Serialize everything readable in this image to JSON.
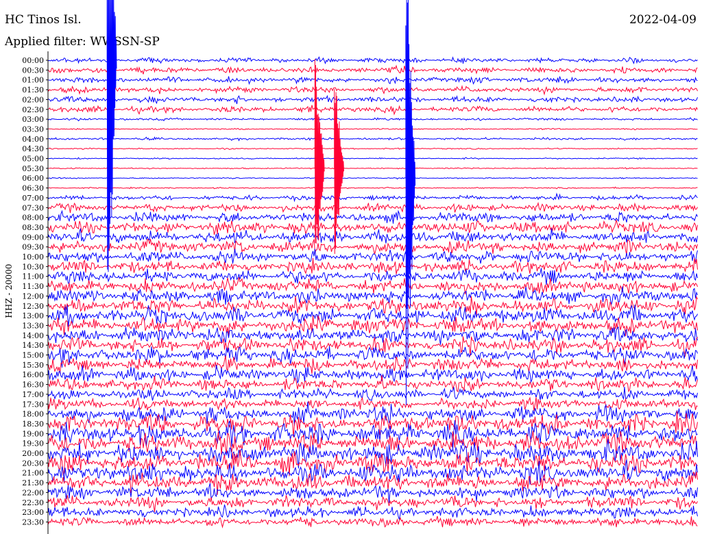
{
  "header": {
    "station": "HC Tinos Isl.",
    "date": "2022-04-09",
    "filter": "Applied filter: WWSSN-SP"
  },
  "channel_label": "HHZ - 20000",
  "colors": {
    "trace_a": "#0000ff",
    "trace_b": "#ff0033",
    "background": "#ffffff"
  },
  "chart_data": {
    "type": "line",
    "title": "HC Tinos Isl.",
    "subtitle": "Applied filter: WWSSN-SP",
    "ylabel": "HHZ - 20000",
    "xlabel": "",
    "y_tick_labels": [
      "00:00",
      "00:30",
      "01:00",
      "01:30",
      "02:00",
      "02:30",
      "03:00",
      "03:30",
      "04:00",
      "04:30",
      "05:00",
      "05:30",
      "06:00",
      "06:30",
      "07:00",
      "07:30",
      "08:00",
      "08:30",
      "09:00",
      "09:30",
      "10:00",
      "10:30",
      "11:00",
      "11:30",
      "12:00",
      "12:30",
      "13:00",
      "13:30",
      "14:00",
      "14:30",
      "15:00",
      "15:30",
      "16:00",
      "16:30",
      "17:00",
      "17:30",
      "18:00",
      "18:30",
      "19:00",
      "19:30",
      "20:00",
      "20:30",
      "21:00",
      "21:30",
      "22:00",
      "22:30",
      "23:00",
      "23:30"
    ],
    "row_colors": [
      "blue",
      "red"
    ],
    "noise_level": [
      4,
      5,
      5,
      5,
      5,
      5,
      2,
      1,
      2,
      1,
      1,
      1,
      1,
      1,
      4,
      6,
      8,
      10,
      10,
      10,
      10,
      10,
      10,
      11,
      11,
      12,
      13,
      13,
      13,
      12,
      12,
      11,
      11,
      10,
      9,
      9,
      13,
      15,
      16,
      16,
      16,
      16,
      15,
      14,
      11,
      10,
      9,
      8
    ],
    "events": [
      {
        "time": "00:00",
        "x_fraction": 0.09,
        "level": 30
      },
      {
        "time": "06:00",
        "x_fraction": 0.55,
        "level": 25
      },
      {
        "time": "05:30",
        "x_fraction": 0.44,
        "level": 10
      },
      {
        "time": "05:30",
        "x_fraction": 0.41,
        "level": 12
      }
    ],
    "grid": false
  }
}
